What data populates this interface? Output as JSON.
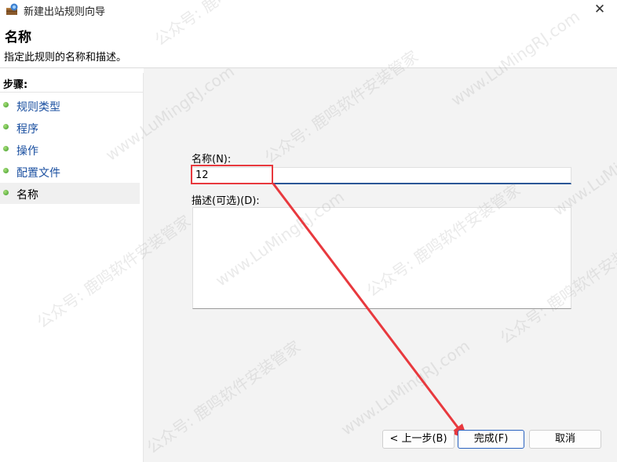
{
  "window": {
    "title": "新建出站规则向导",
    "close_glyph": "✕"
  },
  "header": {
    "title": "名称",
    "description": "指定此规则的名称和描述。"
  },
  "sidebar": {
    "heading": "步骤:",
    "items": [
      {
        "label": "规则类型"
      },
      {
        "label": "程序"
      },
      {
        "label": "操作"
      },
      {
        "label": "配置文件"
      },
      {
        "label": "名称"
      }
    ]
  },
  "form": {
    "name_label": "名称(N):",
    "name_value": "12",
    "description_label": "描述(可选)(D):",
    "description_value": ""
  },
  "buttons": {
    "back": "< 上一步(B)",
    "finish": "完成(F)",
    "cancel": "取消"
  },
  "watermark": {
    "text_cn": "公众号: 鹿鸣软件安装管家",
    "text_en": "www.LuMingRJ.com"
  },
  "colors": {
    "annotation": "#e8393e",
    "accent": "#2b5797",
    "link": "#1a4fa0"
  },
  "icons": {
    "app": "firewall-wizard-icon",
    "step_bullet": "green-dot-icon",
    "close": "close-icon"
  }
}
